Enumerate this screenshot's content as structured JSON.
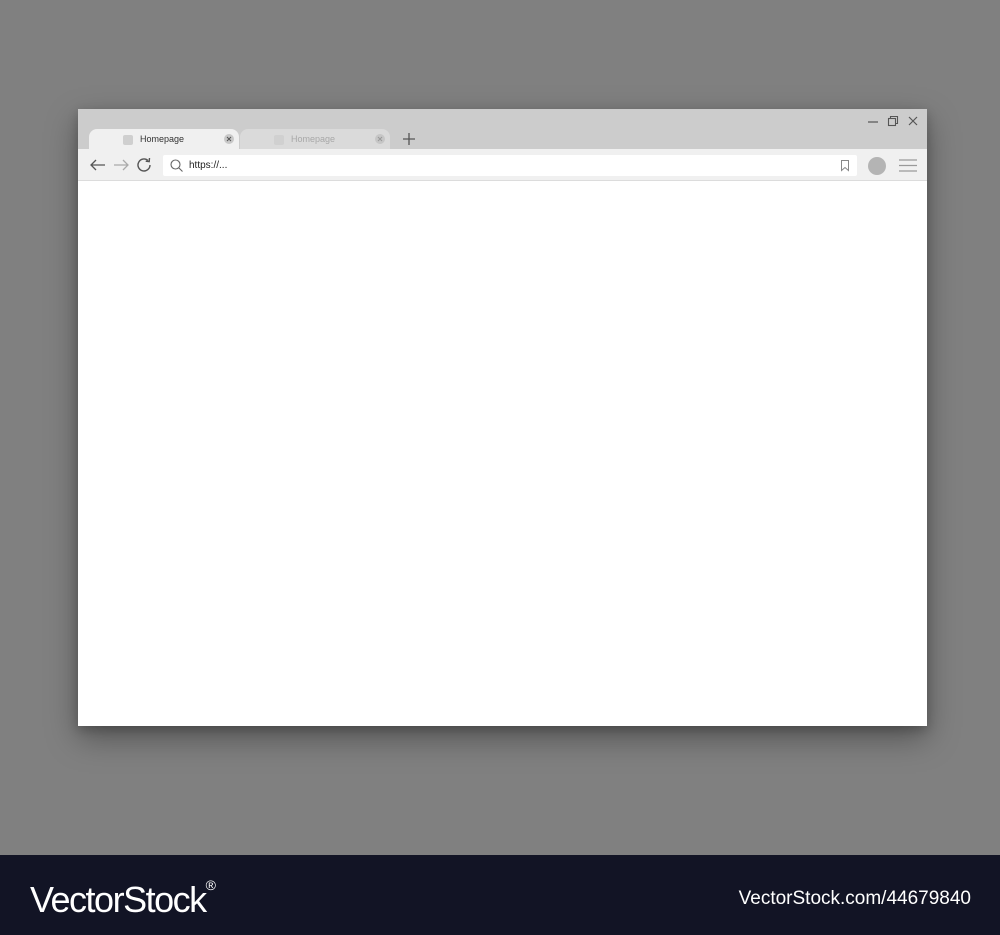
{
  "browser": {
    "tabs": [
      {
        "label": "Homepage",
        "active": true
      },
      {
        "label": "Homepage",
        "active": false
      }
    ],
    "address_bar": {
      "value": "https://..."
    },
    "icons": {
      "back": "arrow-left-icon",
      "forward": "arrow-right-icon",
      "reload": "reload-icon",
      "search": "search-icon",
      "bookmark": "bookmark-icon",
      "profile": "profile-avatar",
      "menu": "hamburger-menu-icon",
      "new_tab": "plus-icon",
      "minimize": "minimize-icon",
      "restore": "restore-icon",
      "close": "close-icon"
    }
  },
  "watermark": {
    "brand_vector": "Vector",
    "brand_stock": "Stock",
    "brand_reg": "®",
    "image_id": "VectorStock.com/44679840"
  },
  "colors": {
    "background": "#808080",
    "titlebar": "#cccccc",
    "toolbar": "#f0f0f0",
    "footer": "#121425"
  }
}
